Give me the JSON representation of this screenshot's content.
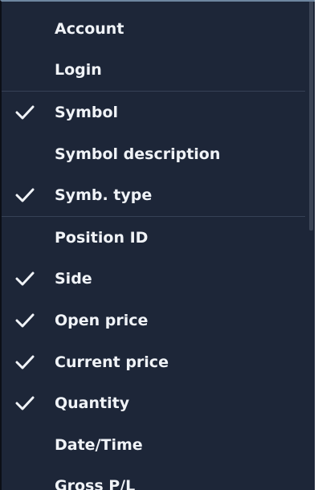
{
  "menu": {
    "groups": [
      [
        {
          "label": "Account",
          "checked": false
        },
        {
          "label": "Login",
          "checked": false
        }
      ],
      [
        {
          "label": "Symbol",
          "checked": true
        },
        {
          "label": "Symbol description",
          "checked": false
        },
        {
          "label": "Symb. type",
          "checked": true
        }
      ],
      [
        {
          "label": "Position ID",
          "checked": false
        },
        {
          "label": "Side",
          "checked": true
        },
        {
          "label": "Open price",
          "checked": true
        },
        {
          "label": "Current price",
          "checked": true
        },
        {
          "label": "Quantity",
          "checked": true
        },
        {
          "label": "Date/Time",
          "checked": false
        },
        {
          "label": "Gross P/L",
          "checked": false
        }
      ]
    ],
    "check_icon": "checkmark-icon"
  }
}
